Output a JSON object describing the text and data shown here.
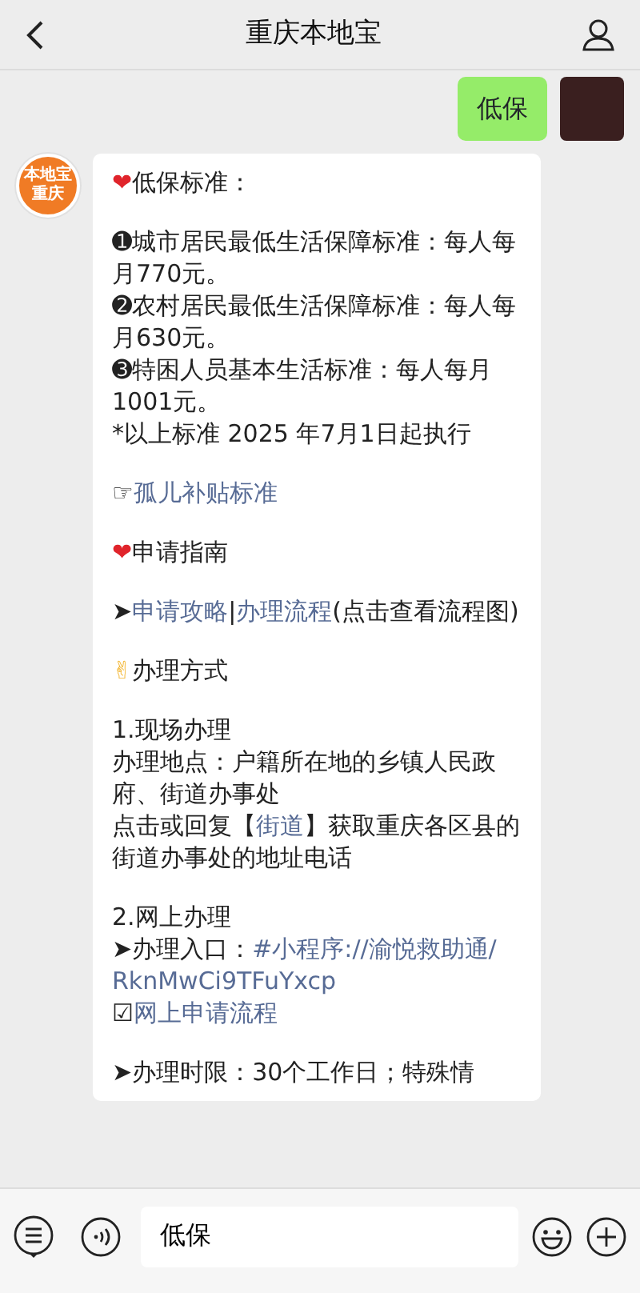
{
  "header": {
    "title": "重庆本地宝"
  },
  "outgoing": {
    "text": "低保"
  },
  "account_logo": {
    "top": "本地宝",
    "bottom": "重庆"
  },
  "incoming": {
    "blocks": [
      [
        [
          {
            "kind": "emoji",
            "t": "❤"
          },
          {
            "kind": "text",
            "t": "低保标准："
          }
        ]
      ],
      [
        [
          {
            "kind": "text",
            "t": "➊城市居民最低生活保障标准：每人每月770元。"
          }
        ],
        [
          {
            "kind": "text",
            "t": "➋农村居民最低生活保障标准：每人每月630元。"
          }
        ],
        [
          {
            "kind": "text",
            "t": "➌特困人员基本生活标准：每人每月1001元。"
          }
        ],
        [
          {
            "kind": "text",
            "t": "*以上标准 2025 年7月1日起执行"
          }
        ]
      ],
      [
        [
          {
            "kind": "text",
            "t": "☞"
          },
          {
            "kind": "link",
            "t": "孤儿补贴标准"
          }
        ]
      ],
      [
        [
          {
            "kind": "emoji",
            "t": "❤"
          },
          {
            "kind": "text",
            "t": "申请指南"
          }
        ]
      ],
      [
        [
          {
            "kind": "text",
            "t": "➤"
          },
          {
            "kind": "link",
            "t": "申请攻略"
          },
          {
            "kind": "text",
            "t": "|"
          },
          {
            "kind": "link",
            "t": "办理流程"
          },
          {
            "kind": "text",
            "t": "(点击查看流程图)"
          }
        ]
      ],
      [
        [
          {
            "kind": "hand",
            "t": "✌"
          },
          {
            "kind": "text",
            "t": "办理方式"
          }
        ]
      ],
      [
        [
          {
            "kind": "text",
            "t": "1.现场办理"
          }
        ],
        [
          {
            "kind": "text",
            "t": "办理地点：户籍所在地的乡镇人民政府、街道办事处"
          }
        ],
        [
          {
            "kind": "text",
            "t": "点击或回复【"
          },
          {
            "kind": "link",
            "t": "街道"
          },
          {
            "kind": "text",
            "t": "】获取重庆各区县的街道办事处的地址电话"
          }
        ]
      ],
      [
        [
          {
            "kind": "text",
            "t": "2.网上办理"
          }
        ],
        [
          {
            "kind": "text",
            "t": "➤办理入口："
          },
          {
            "kind": "link",
            "t": "#小程序://渝悦救助通/"
          }
        ],
        [
          {
            "kind": "link",
            "t": "RknMwCi9TFuYxcp"
          }
        ],
        [
          {
            "kind": "text",
            "t": "☑"
          },
          {
            "kind": "link",
            "t": "网上申请流程"
          }
        ]
      ],
      [
        [
          {
            "kind": "text",
            "t": "➤办理时限：30个工作日；特殊情"
          }
        ]
      ]
    ]
  },
  "input_bar": {
    "value": "低保"
  }
}
